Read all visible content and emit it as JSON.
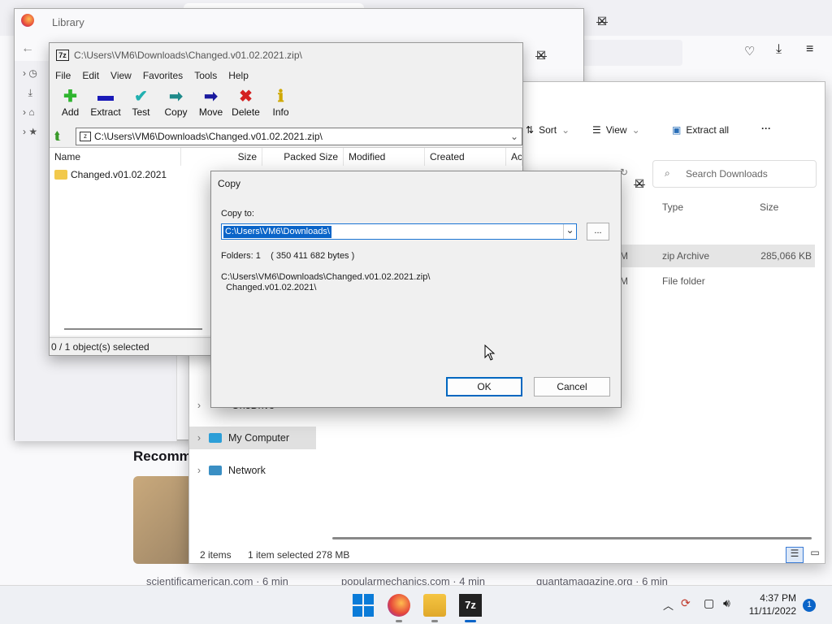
{
  "firefox": {
    "recommended_heading": "Recomm",
    "cards": [
      {
        "source": "scientificamerican.com · 6 min"
      },
      {
        "source": "popularmechanics.com · 4 min"
      },
      {
        "source": "quantamagazine.org · 6 min"
      }
    ]
  },
  "library": {
    "title": "Library"
  },
  "explorer": {
    "cmdbar": {
      "sort_label": "Sort",
      "view_label": "View",
      "extract_all_label": "Extract all",
      "more_label": "···"
    },
    "search_placeholder": "Search Downloads",
    "columns": {
      "type": "Type",
      "size": "Size"
    },
    "rows": [
      {
        "type": "zip Archive",
        "size": "285,066 KB",
        "date_suffix": "M"
      },
      {
        "type": "File folder",
        "size": "",
        "date_suffix": "M"
      }
    ],
    "nav": {
      "onedrive": "OneDrive",
      "my_computer": "My Computer",
      "network": "Network"
    },
    "status": {
      "items": "2 items",
      "selected": "1 item selected",
      "size": "278 MB"
    }
  },
  "sevenzip": {
    "title": "C:\\Users\\VM6\\Downloads\\Changed.v01.02.2021.zip\\",
    "menu": [
      "File",
      "Edit",
      "View",
      "Favorites",
      "Tools",
      "Help"
    ],
    "toolbar": [
      {
        "label": "Add",
        "icon": "plus-icon",
        "color": "#2fb52f"
      },
      {
        "label": "Extract",
        "icon": "minus-icon",
        "color": "#1a1ab8"
      },
      {
        "label": "Test",
        "icon": "check-icon",
        "color": "#22b0b0"
      },
      {
        "label": "Copy",
        "icon": "copy-arrow-icon",
        "color": "#1e8a8a"
      },
      {
        "label": "Move",
        "icon": "move-arrow-icon",
        "color": "#1a1a9e"
      },
      {
        "label": "Delete",
        "icon": "x-icon",
        "color": "#d42020"
      },
      {
        "label": "Info",
        "icon": "info-icon",
        "color": "#cfa800"
      }
    ],
    "path": "C:\\Users\\VM6\\Downloads\\Changed.v01.02.2021.zip\\",
    "columns": {
      "name": "Name",
      "size": "Size",
      "packed": "Packed Size",
      "modified": "Modified",
      "created": "Created",
      "accessed": "Ac"
    },
    "rows": [
      {
        "name": "Changed.v01.02.2021"
      }
    ],
    "status": "0 / 1 object(s) selected"
  },
  "copy_dialog": {
    "title": "Copy",
    "copy_to_label": "Copy to:",
    "destination": "C:\\Users\\VM6\\Downloads\\",
    "browse_label": "...",
    "folders_info": "Folders: 1    ( 350 411 682 bytes )",
    "source_line1": "C:\\Users\\VM6\\Downloads\\Changed.v01.02.2021.zip\\",
    "source_line2": "  Changed.v01.02.2021\\",
    "ok_label": "OK",
    "cancel_label": "Cancel"
  },
  "taskbar": {
    "time": "4:37 PM",
    "date": "11/11/2022",
    "notification_count": "1"
  }
}
